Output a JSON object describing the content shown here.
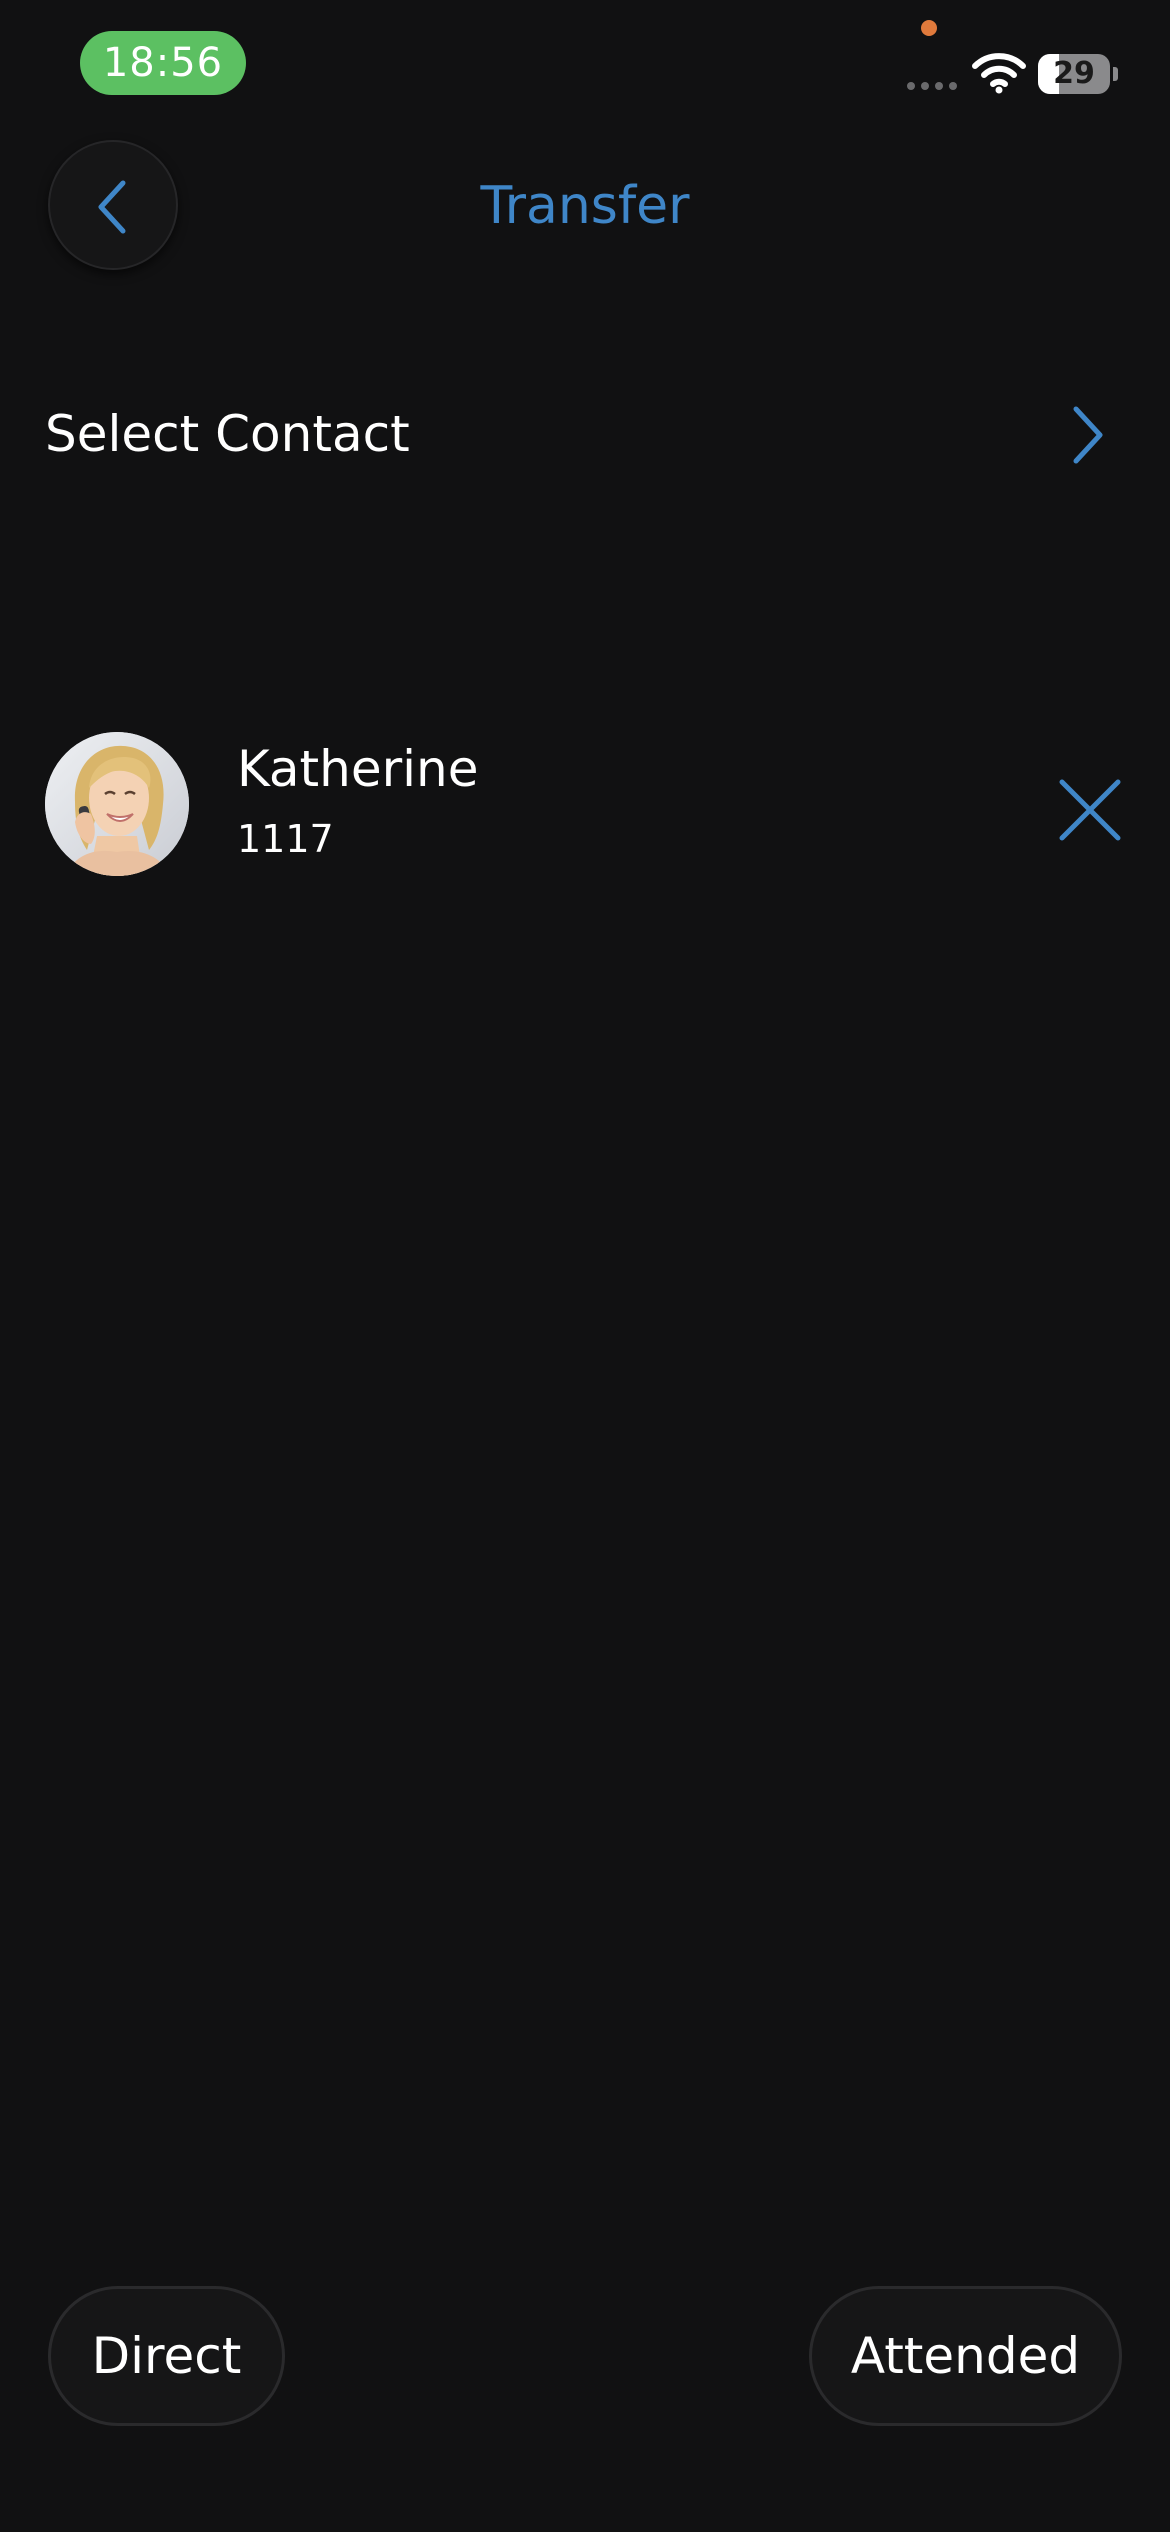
{
  "status_bar": {
    "time": "18:56",
    "battery_level": "29",
    "battery_fraction": 0.29,
    "icons": [
      "signal-dots-icon",
      "wifi-icon",
      "battery-icon"
    ],
    "time_pill_color": "#5cc062",
    "privacy_dot_color": "#e07a3c"
  },
  "header": {
    "title": "Transfer",
    "back_icon": "chevron-left-icon"
  },
  "select_contact": {
    "label": "Select Contact",
    "icon": "chevron-right-icon"
  },
  "selected_contact": {
    "name": "Katherine",
    "number": "1117",
    "avatar": "avatar-photo",
    "remove_icon": "close-icon"
  },
  "actions": {
    "direct_label": "Direct",
    "attended_label": "Attended"
  },
  "colors": {
    "background": "#111112",
    "accent": "#3f86c8",
    "text": "#ffffff",
    "button_background": "#161617"
  }
}
